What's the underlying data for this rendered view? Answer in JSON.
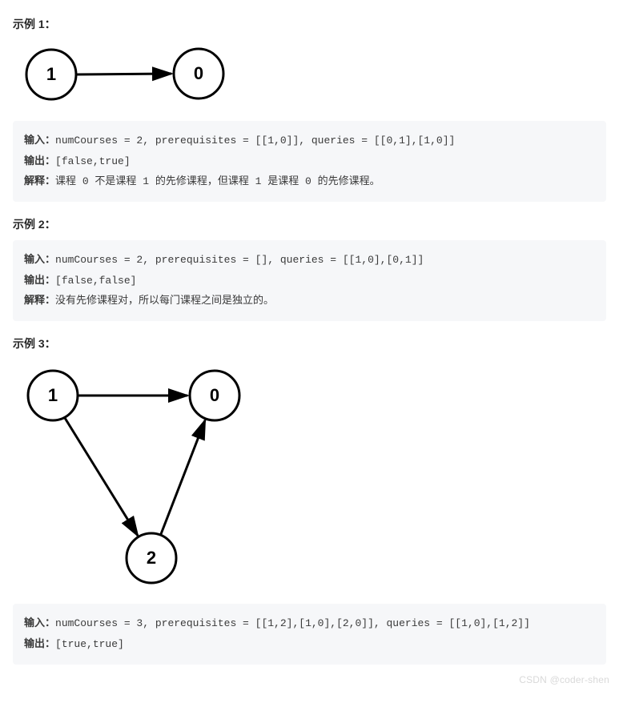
{
  "labels": {
    "input": "输入：",
    "output": "输出：",
    "explain": "解释："
  },
  "examples": [
    {
      "title": "示例 1：",
      "graph": {
        "nodes": [
          "1",
          "0"
        ],
        "edges": [
          [
            "1",
            "0"
          ]
        ]
      },
      "input": "numCourses = 2, prerequisites = [[1,0]], queries = [[0,1],[1,0]]",
      "output": "[false,true]",
      "explain": "课程 0 不是课程 1 的先修课程，但课程 1 是课程 0 的先修课程。"
    },
    {
      "title": "示例 2：",
      "graph": null,
      "input": "numCourses = 2, prerequisites = [], queries = [[1,0],[0,1]]",
      "output": "[false,false]",
      "explain": "没有先修课程对，所以每门课程之间是独立的。"
    },
    {
      "title": "示例 3：",
      "graph": {
        "nodes": [
          "1",
          "0",
          "2"
        ],
        "edges": [
          [
            "1",
            "0"
          ],
          [
            "1",
            "2"
          ],
          [
            "2",
            "0"
          ]
        ]
      },
      "input": "numCourses = 3, prerequisites = [[1,2],[1,0],[2,0]], queries = [[1,0],[1,2]]",
      "output": "[true,true]",
      "explain": null
    }
  ],
  "watermark": "CSDN @coder-shen"
}
